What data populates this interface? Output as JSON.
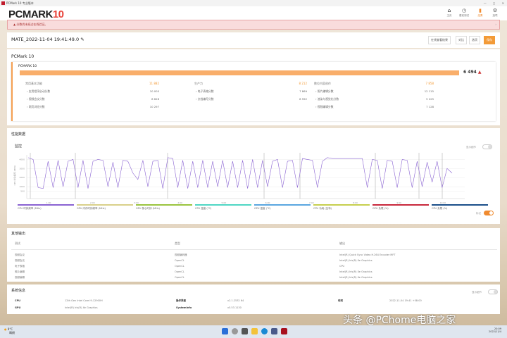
{
  "window": {
    "title": "PCMark 10 专业版本",
    "controls": "— ◻ ✕"
  },
  "header": {
    "logo_main": "PCMARK",
    "logo_num": "10",
    "nav": [
      {
        "icon": "home-icon",
        "glyph": "⌂",
        "label": "主页"
      },
      {
        "icon": "gauge-icon",
        "glyph": "◷",
        "label": "基准测试"
      },
      {
        "icon": "chart-icon",
        "glyph": "▮",
        "label": "结果"
      },
      {
        "icon": "gear-icon",
        "glyph": "⚙",
        "label": "选项"
      }
    ]
  },
  "warning": {
    "text": "分数尚未经过在线验证。",
    "close": "›"
  },
  "result": {
    "name": "MATE_2022-11-04 19:41:49.0",
    "buttons": [
      "在线查看结果",
      "对比",
      "选项",
      "保存"
    ]
  },
  "pcmark": {
    "section_title": "PCMark 10",
    "card_title": "PCMARK 10",
    "score": "6 494",
    "progress_percent": 100,
    "groups": [
      {
        "label": "常用基本功能",
        "value": "11 882",
        "rows": [
          {
            "label": "应用程序启动分数",
            "value": "10 005"
          },
          {
            "label": "视频会议分数",
            "value": "8 628"
          },
          {
            "label": "网页浏览分数",
            "value": "10 297"
          }
        ]
      },
      {
        "label": "生产力",
        "value": "8 212",
        "rows": [
          {
            "label": "电子表格分数",
            "value": "7 869"
          },
          {
            "label": "文档编写分数",
            "value": "8 592"
          }
        ]
      },
      {
        "label": "数位内容创作",
        "value": "7 858",
        "rows": [
          {
            "label": "照片编辑分数",
            "value": "12 115"
          },
          {
            "label": "渲染与视觉化分数",
            "value": "5 225"
          },
          {
            "label": "视频编辑分数",
            "value": "7 128"
          }
        ]
      }
    ]
  },
  "perf": {
    "title": "性能数据",
    "monitor": "监控",
    "toggle_label": "显示细节",
    "bottom_toggle_label": "标记",
    "legend": [
      {
        "label": "CPU 时钟频率 (MHz)",
        "color": "#8a63d2"
      },
      {
        "label": "GPU 内存时钟频率 (MHz)",
        "color": "#d9d08a"
      },
      {
        "label": "GPU 核心时钟 (MHz)",
        "color": "#9ac43e"
      },
      {
        "label": "CPU 温度 (°C)",
        "color": "#4fd6c4"
      },
      {
        "label": "GPU 温度 (°C)",
        "color": "#5aa6e0"
      },
      {
        "label": "CPU 功耗 (瓦特)",
        "color": "#c6cf4e"
      },
      {
        "label": "GPU 负载 (%)",
        "color": "#c8283c"
      },
      {
        "label": "CPU 负载 (%)",
        "color": "#1b4f8a"
      }
    ]
  },
  "chart_data": {
    "type": "line",
    "ylabel": "CPU 时钟频率 (MHz)",
    "ylim": [
      0,
      4500
    ],
    "yticks": [
      "4000",
      "3000",
      "2000",
      "1000",
      "500"
    ],
    "xticks": [
      "1:00",
      "2:00",
      "3:00",
      "4:00",
      "5:00",
      "6:00",
      "7:00",
      "8:00",
      "9:00",
      "10:00"
    ],
    "series": [
      {
        "name": "CPU 时钟频率 (MHz)",
        "color": "#8a63d2",
        "values": [
          4200,
          4000,
          900,
          800,
          3800,
          900,
          3900,
          1000,
          3800,
          4000,
          900,
          3900,
          800,
          3800,
          4000,
          3900,
          1000,
          3700,
          900,
          3900,
          3800,
          2500,
          1800,
          3900,
          1000,
          3800,
          3900,
          800,
          4200,
          4100,
          900,
          3900,
          800,
          3800,
          900,
          3900,
          900,
          3800,
          1000,
          3900,
          900,
          3800,
          900,
          3900,
          800,
          4000,
          900,
          3900,
          1000,
          3800,
          4000,
          900,
          3800,
          3900,
          900,
          4100,
          4000,
          3900,
          900,
          3800,
          4200,
          4100,
          4100,
          4100,
          4100,
          4100,
          4100,
          4100,
          900,
          4000,
          3900,
          800,
          3900,
          3800,
          900,
          4000,
          3900,
          900,
          3800,
          1000,
          3700,
          1500,
          3800,
          900,
          3000,
          2500
        ]
      }
    ]
  },
  "other": {
    "title": "其他输出",
    "headers": [
      "测试",
      "类型",
      "输出"
    ],
    "rows": [
      [
        "视频会议",
        "视频编码器",
        "Intel(R) Quick Sync Video H.264 Encoder MFT"
      ],
      [
        "视频会议",
        "OpenCL",
        "Intel(R) Iris(R) Xe Graphics"
      ],
      [
        "电子表格",
        "OpenCL",
        "CPU"
      ],
      [
        "照片编辑",
        "OpenCL",
        "Intel(R) Iris(R) Xe Graphics"
      ],
      [
        "视频编辑",
        "OpenCL",
        "Intel(R) Iris(R) Xe Graphics"
      ]
    ]
  },
  "sys": {
    "title": "系统信息",
    "toggle_label": "显示细节",
    "rows": [
      [
        {
          "k": "CPU",
          "v": "12th Gen Intel Core i9-12900H"
        },
        {
          "k": "操作界面",
          "v": "v2.1.2532 64"
        },
        {
          "k": "时间",
          "v": "2022-11-04 19:41 +08:00"
        }
      ],
      [
        {
          "k": "GPU",
          "v": "Intel(R) Iris(R) Xe Graphics"
        },
        {
          "k": "SystemInfo",
          "v": "v5.53.1130"
        }
      ]
    ]
  },
  "taskbar": {
    "weather": "9°C",
    "weather_sub": "晴朗",
    "time": "20:09",
    "date": "2022/11/4"
  },
  "watermark": "头条 @PChome电脑之家"
}
